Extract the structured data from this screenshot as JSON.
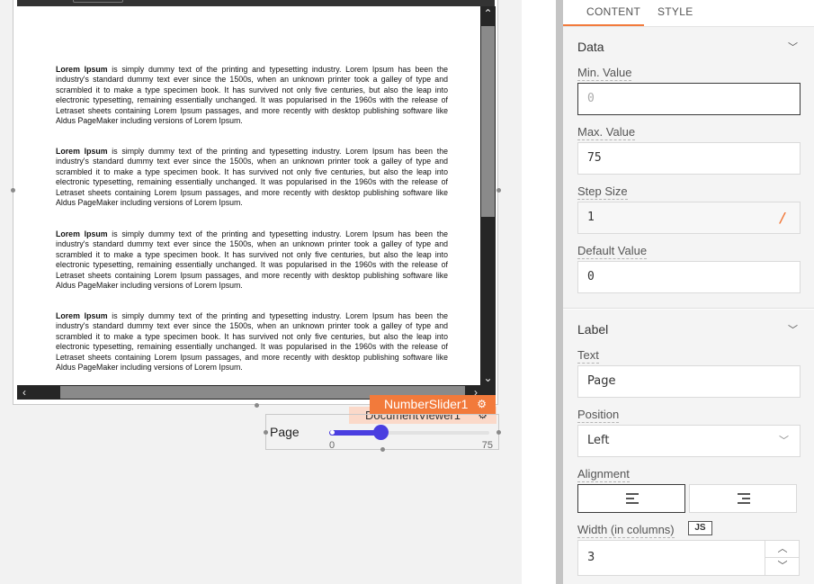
{
  "document": {
    "paragraph_lead": "Lorem Ipsum",
    "paragraph_body": " is simply dummy text of the printing and typesetting industry. Lorem Ipsum has been the industry's standard dummy text ever since the 1500s, when an unknown printer took a galley of type and scrambled it to make a type specimen book. It has survived not only five centuries, but also the leap into electronic typesetting, remaining essentially unchanged. It was popularised in the 1960s with the release of Letraset sheets containing Lorem Ipsum passages, and more recently with desktop publishing software like Aldus PageMaker including versions of Lorem Ipsum."
  },
  "widgets": {
    "number_slider_tag": "NumberSlider1",
    "document_viewer_tag": "DocumentViewer1"
  },
  "slider": {
    "label": "Page",
    "min_text": "0",
    "max_text": "75",
    "value_fraction": 0.32
  },
  "panel": {
    "tabs": [
      "CONTENT",
      "STYLE"
    ],
    "data_section": {
      "title": "Data",
      "min_label": "Min. Value",
      "min_value": "0",
      "max_label": "Max. Value",
      "max_value": "75",
      "step_label": "Step Size",
      "step_value": "1",
      "default_label": "Default Value",
      "default_value": "0"
    },
    "label_section": {
      "title": "Label",
      "text_label": "Text",
      "text_value": "Page",
      "position_label": "Position",
      "position_value": "Left",
      "alignment_label": "Alignment",
      "width_label": "Width (in columns)",
      "js_badge": "JS",
      "width_value": "3"
    }
  },
  "colors": {
    "accent": "#f27a3b",
    "slider": "#4a3ee0"
  }
}
